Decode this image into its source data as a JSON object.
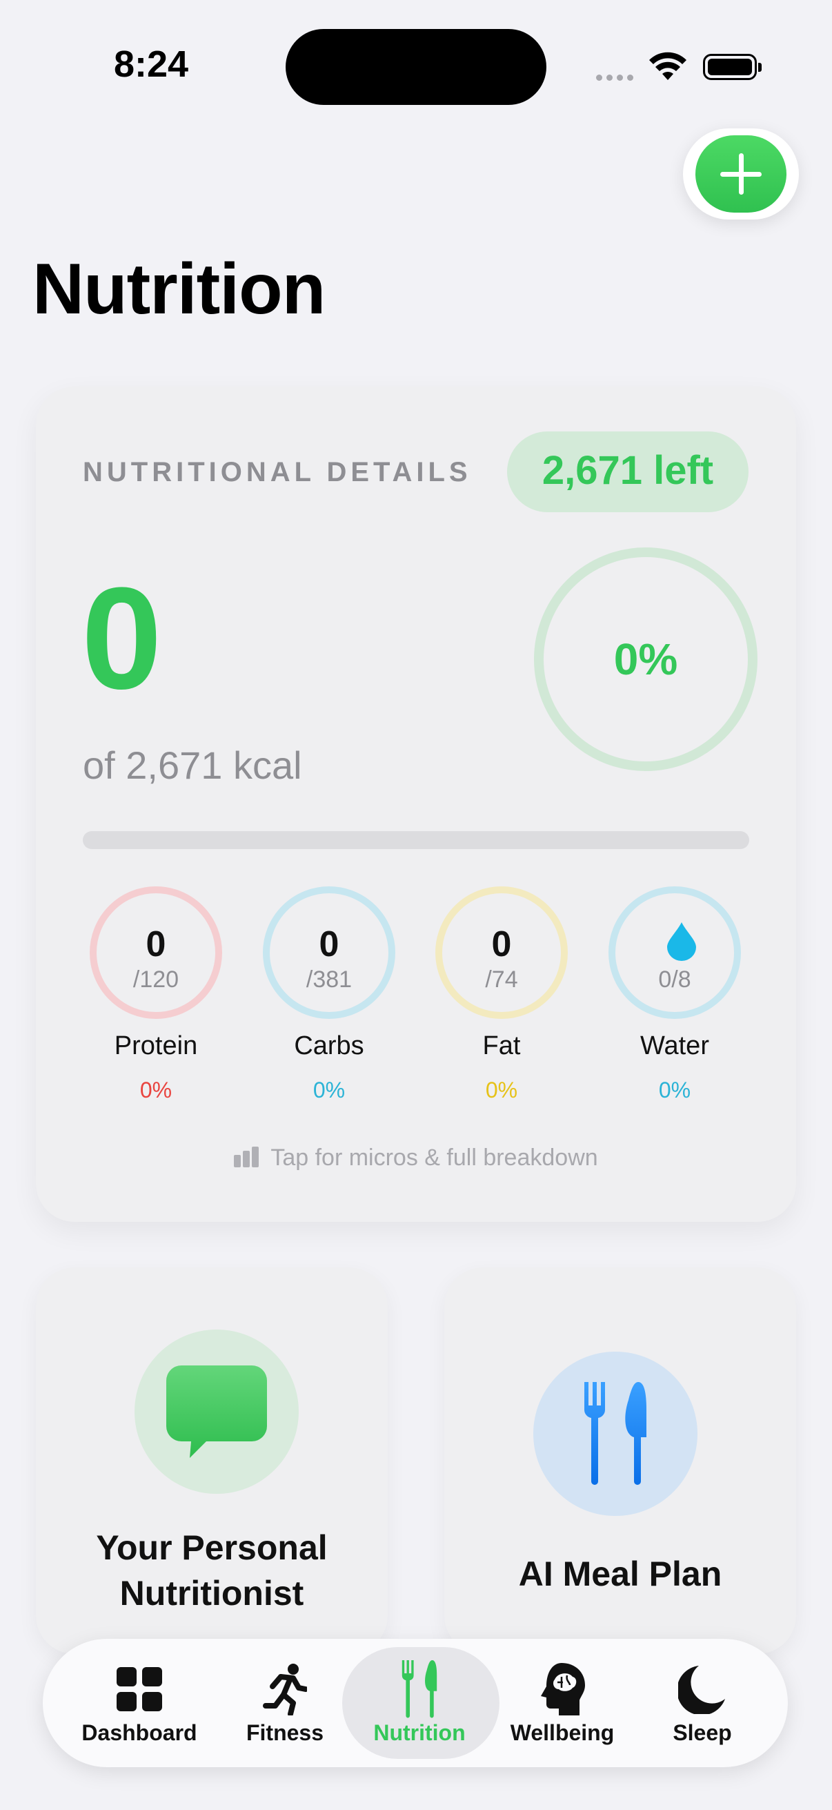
{
  "status_bar": {
    "time": "8:24"
  },
  "header": {
    "title": "Nutrition"
  },
  "summary": {
    "section_label": "NUTRITIONAL DETAILS",
    "remaining_label": "2,671 left",
    "consumed": "0",
    "goal_text": "of 2,671 kcal",
    "progress_percent_label": "0%",
    "progress_fraction": 0
  },
  "macros": [
    {
      "value": "0",
      "goal": "/120",
      "name": "Protein",
      "percent": "0%",
      "ring_color": "#f5cdd0",
      "percent_color": "#e9443f"
    },
    {
      "value": "0",
      "goal": "/381",
      "name": "Carbs",
      "percent": "0%",
      "ring_color": "#c6e6f0",
      "percent_color": "#2bb3d6"
    },
    {
      "value": "0",
      "goal": "/74",
      "name": "Fat",
      "percent": "0%",
      "ring_color": "#f3eabf",
      "percent_color": "#e6c219"
    },
    {
      "value": "",
      "goal": "0/8",
      "name": "Water",
      "percent": "0%",
      "ring_color": "#c6e6f0",
      "percent_color": "#2bb3d6",
      "icon": "water-drop-icon"
    }
  ],
  "hint": {
    "text": "Tap for micros & full breakdown"
  },
  "features": [
    {
      "title_line1": "Your Personal",
      "title_line2": "Nutritionist",
      "icon": "chat-bubble-icon"
    },
    {
      "title_line1": "AI Meal Plan",
      "icon": "fork-knife-icon"
    }
  ],
  "tabs": [
    {
      "label": "Dashboard",
      "icon": "grid-icon"
    },
    {
      "label": "Fitness",
      "icon": "runner-icon"
    },
    {
      "label": "Nutrition",
      "icon": "fork-knife-icon",
      "active": true
    },
    {
      "label": "Wellbeing",
      "icon": "brain-head-icon"
    },
    {
      "label": "Sleep",
      "icon": "moon-icon"
    }
  ],
  "colors": {
    "accent": "#34c759",
    "blue": "#0a84ff"
  }
}
